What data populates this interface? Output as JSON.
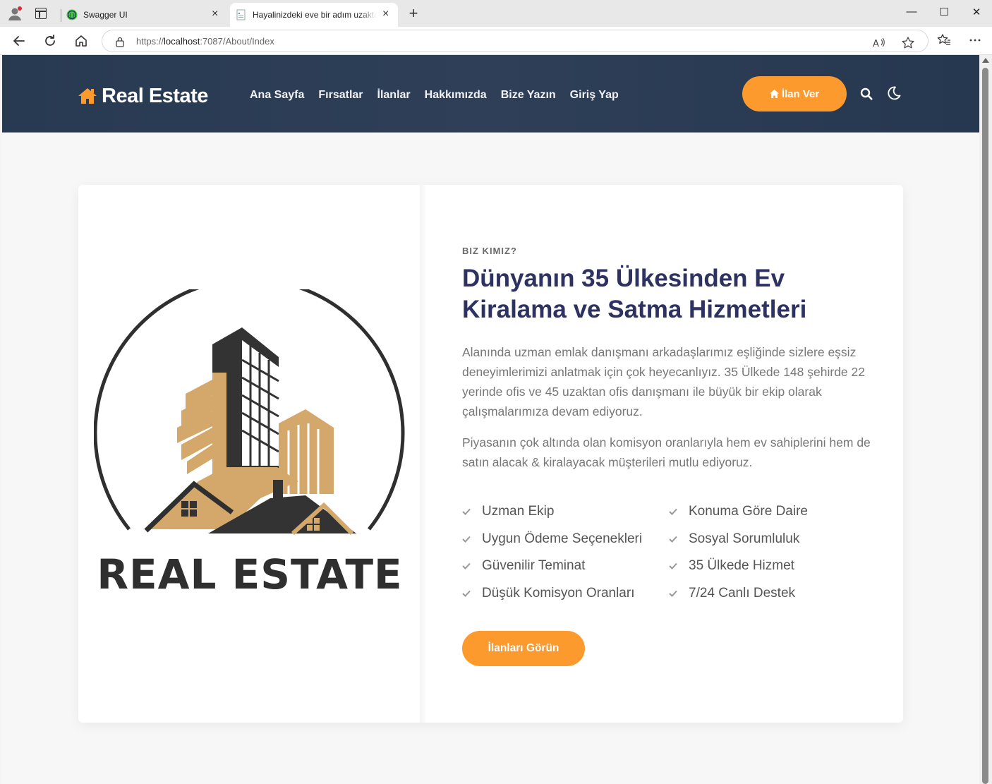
{
  "browser": {
    "tabs": [
      {
        "title": "Swagger UI",
        "active": false
      },
      {
        "title": "Hayalinizdeki eve bir adım uzaktasınız",
        "active": true
      }
    ],
    "new_tab": "+",
    "url_prefix": "https://",
    "url_host": "localhost",
    "url_path": ":7087/About/Index",
    "controls": {
      "minimize": "—",
      "maximize": "☐",
      "close": "✕"
    }
  },
  "site": {
    "brand": "Real Estate",
    "nav": [
      "Ana Sayfa",
      "Fırsatlar",
      "İlanlar",
      "Hakkımızda",
      "Bize Yazın",
      "Giriş Yap"
    ],
    "cta": "İlan Ver",
    "accent": "#fd9a2e",
    "nav_bg": "#2b3d55"
  },
  "about": {
    "logo_text": "REAL ESTATE",
    "eyebrow": "BIZ KIMIZ?",
    "heading_line1": "Dünyanın 35 Ülkesinden Ev",
    "heading_line2": "Kiralama ve Satma Hizmetleri",
    "paragraph1": "Alanında uzman emlak danışmanı arkadaşlarımız eşliğinde sizlere eşsiz deneyimlerimizi anlatmak için çok heyecanlıyız. 35 Ülkede 148 şehirde 22 yerinde ofis ve 45 uzaktan ofis danışmanı ile büyük bir ekip olarak çalışmalarımıza devam ediyoruz.",
    "paragraph2": "Piyasanın çok altında olan komisyon oranlarıyla hem ev sahiplerini hem de satın alacak & kiralayacak müşterileri mutlu ediyoruz.",
    "features_left": [
      "Uzman Ekip",
      "Uygun Ödeme Seçenekleri",
      "Güvenilir Teminat",
      "Düşük Komisyon Oranları"
    ],
    "features_right": [
      "Konuma Göre Daire",
      "Sosyal Sorumluluk",
      "35 Ülkede Hizmet",
      "7/24 Canlı Destek"
    ],
    "button": "İlanları Görün",
    "heading_color": "#2d3260"
  }
}
